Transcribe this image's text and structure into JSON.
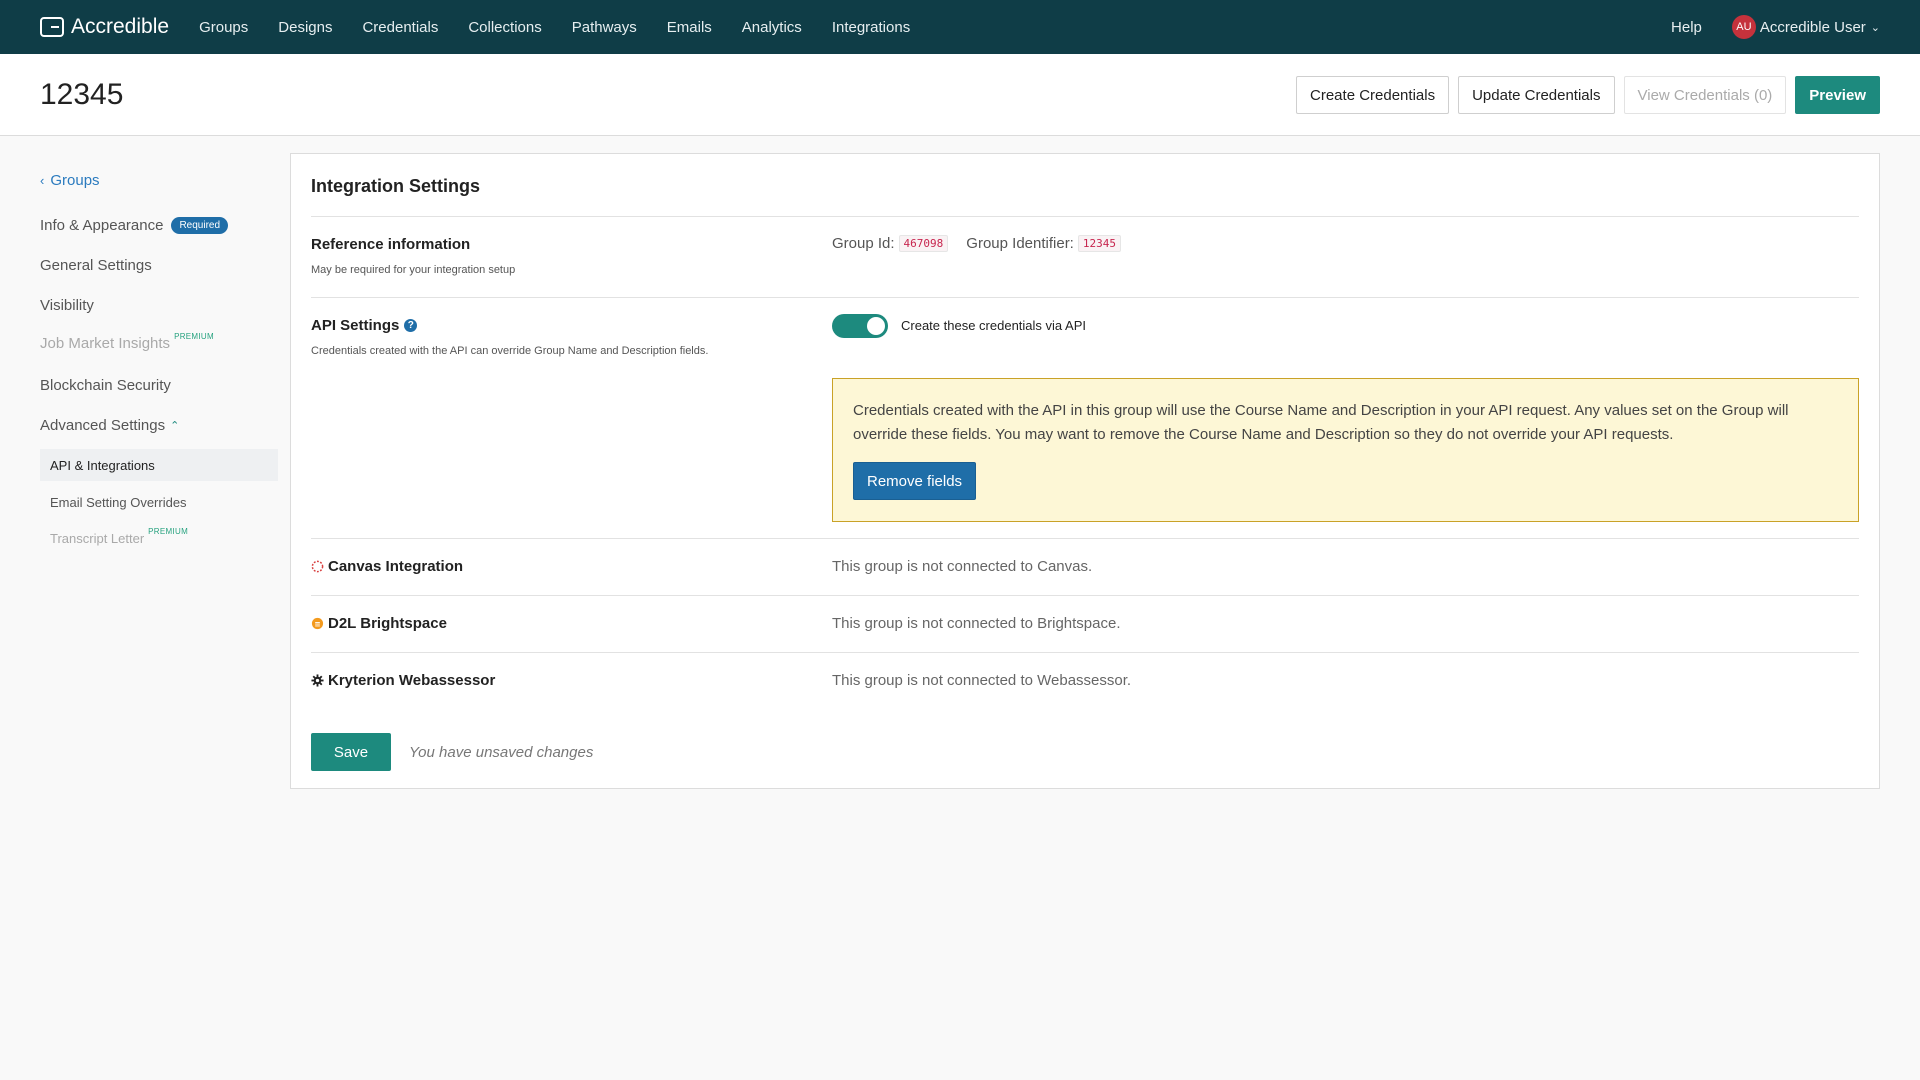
{
  "nav": {
    "brand": "Accredible",
    "links": [
      "Groups",
      "Designs",
      "Credentials",
      "Collections",
      "Pathways",
      "Emails",
      "Analytics",
      "Integrations"
    ],
    "help": "Help",
    "avatar_initials": "AU",
    "user_name": "Accredible User"
  },
  "header": {
    "title": "12345",
    "buttons": {
      "create": "Create Credentials",
      "update": "Update Credentials",
      "view": "View Credentials (0)",
      "preview": "Preview"
    }
  },
  "sidebar": {
    "back": "Groups",
    "items": {
      "info": "Info & Appearance",
      "info_badge": "Required",
      "general": "General Settings",
      "visibility": "Visibility",
      "job_market": "Job Market Insights",
      "premium": "PREMIUM",
      "blockchain": "Blockchain Security",
      "advanced": "Advanced Settings"
    },
    "sub_items": {
      "api": "API & Integrations",
      "email": "Email Setting Overrides",
      "transcript": "Transcript Letter",
      "premium": "PREMIUM"
    }
  },
  "card": {
    "title": "Integration Settings",
    "reference": {
      "title": "Reference information",
      "subtitle": "May be required for your integration setup",
      "group_id_label": "Group Id:",
      "group_id": "467098",
      "group_identifier_label": "Group Identifier:",
      "group_identifier": "12345"
    },
    "api": {
      "title": "API Settings",
      "help_glyph": "?",
      "subtitle": "Credentials created with the API can override Group Name and Description fields.",
      "toggle_on": true,
      "toggle_label": "Create these credentials via API",
      "notice": "Credentials created with the API in this group will use the Course Name and Description in your API request. Any values set on the Group will override these fields. You may want to remove the Course Name and Description so they do not override your API requests.",
      "remove_button": "Remove fields"
    },
    "integrations": [
      {
        "name": "Canvas Integration",
        "status": "This group is not connected to Canvas.",
        "icon": "canvas-icon"
      },
      {
        "name": "D2L Brightspace",
        "status": "This group is not connected to Brightspace.",
        "icon": "d2l-icon"
      },
      {
        "name": "Kryterion Webassessor",
        "status": "This group is not connected to Webassessor.",
        "icon": "gear-icon"
      }
    ],
    "save": "Save",
    "unsaved": "You have unsaved changes"
  },
  "colors": {
    "nav_bg": "#0f3d47",
    "accent": "#1d8a7e",
    "link": "#2b7bbf",
    "notice_bg": "#fdf7d6",
    "avatar": "#c5323c"
  }
}
